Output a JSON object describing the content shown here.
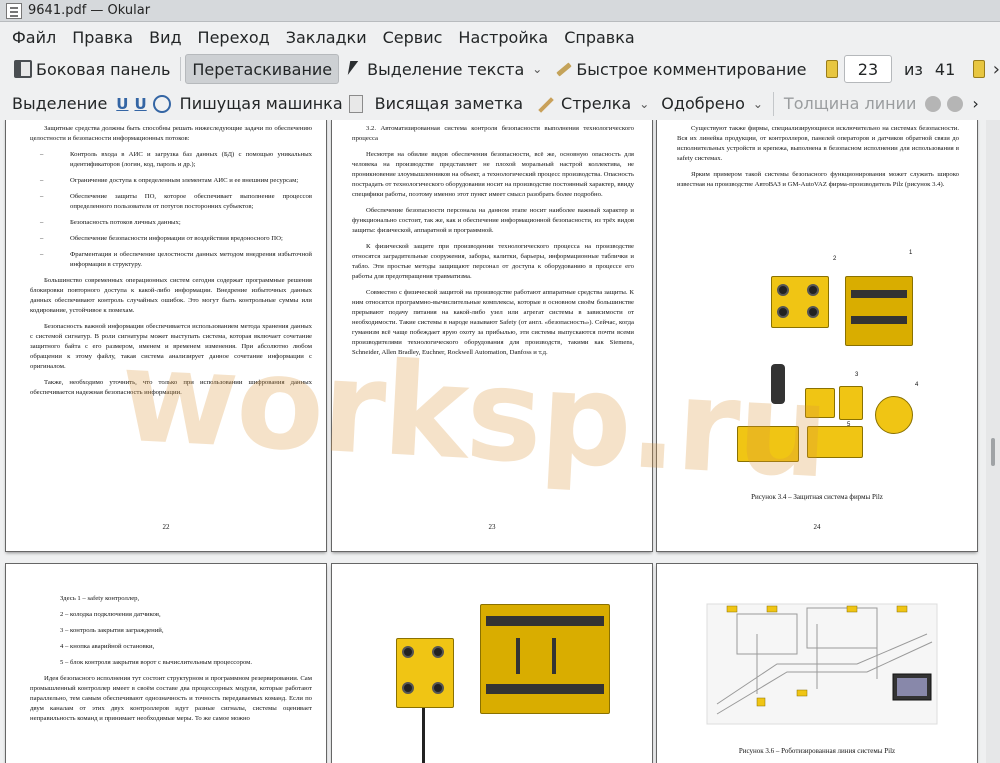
{
  "window": {
    "title": "9641.pdf  — Okular"
  },
  "menubar": {
    "items": [
      "Файл",
      "Правка",
      "Вид",
      "Переход",
      "Закладки",
      "Сервис",
      "Настройка",
      "Справка"
    ]
  },
  "toolbar1": {
    "sidebar": "Боковая панель",
    "drag": "Перетаскивание",
    "text_select": "Выделение текста",
    "quick_comment": "Быстрое комментирование",
    "page_current": "23",
    "page_of": "из",
    "page_total": "41"
  },
  "toolbar2": {
    "selection": "Выделение",
    "typewriter": "Пишущая машинка",
    "sticky_note": "Висящая заметка",
    "arrow": "Стрелка",
    "approved": "Одобрено",
    "line_width": "Толщина линии"
  },
  "pages": {
    "p22": {
      "paragraphs": [
        "Защитные средства должны быть способны решать нижеследующие задачи по обеспечению целостности и безопасности информационных потоков:",
        "Контроль входа в АИС и загрузка баз данных (БД) с помощью уникальных идентификаторов (логин, код, пароль и др.);",
        "Ограничение доступа к определенным элементам АИС и ее внешним ресурсам;",
        "Обеспечение защиты ПО, которое обеспечивает выполнение процессов определенного пользователя от потугов посторонних субъектов;",
        "Безопасность потоков личных данных;",
        "Обеспечение безопасности информации от воздействия вредоносного ПО;",
        "Фрагментация и обеспечение целостности данных методом внедрения избыточной информации в структуру.",
        "Большинство современных операционных систем сегодня содержат программные решения блокировки повторного доступа к какой-либо информации. Внедрение избыточных данных данных обеспечивают контроль случайных ошибок. Это могут быть контрольные суммы или кодирование, устойчивое к помехам.",
        "Безопасность важной информации обеспечивается использованием метода хранения данных с системой сигнатур. В роли сигнатуры может выступать система, которая включает сочетание защитного байта с его размером, именем и временем изменения. При абсолютно любом обращении к этому файлу, такая система анализирует данное сочетание информации с оригиналом.",
        "Также, необходимо уточнить, что только при использовании шифрования данных обеспечивается надежная безопасность информации."
      ],
      "number": "22"
    },
    "p23": {
      "paragraphs": [
        "3.2. Автоматизированная система контроля безопасности выполнения технологического процесса",
        "Несмотря на обилие видов обеспечения безопасности, всё же, основную опасность для человека на производстве представляет не плохой моральный настрой коллектива, не проникновение злоумышленников на объект, а технологический процесс производства. Опасность пострадать от технологического оборудования носит на производстве постоянный характер, ввиду специфики работы, поэтому именно этот пункт имеет смысл разобрать более подробно.",
        "Обеспечение безопасности персонала на данном этапе носит наиболее важный характер и функционально состоит, так же, как и обеспечение информационной безопасности, из трёх видов защиты: физической, аппаратной и программной.",
        "К физической защите при производении технологического процесса на производстве относятся заградительные сооружения, заборы, калитки, барьеры, информационные таблички и табло. Эти простые методы защищают персонал от доступа к оборудованию в процессе его работы для предотвращения травматизма.",
        "Совместно с физической защитой на производстве работают аппаратные средства защиты. К ним относятся программно-вычислительные комплексы, которые в основном своём большинстве прерывают подачу питания на какой-либо узел или агрегат системы в зависимости от необходимости. Такие системы в народе называют Safety (от англ. «безопасность»). Сейчас, когда гуманизм всё чаще побеждает ярую охоту за прибылью, эти системы выпускаются почти всеми производителями технологического оборудования для производств, такими как Siemens, Schneider, Allen Bradley, Euchner, Rockwell Automation, Danfoss и т.д."
      ],
      "number": "23"
    },
    "p24": {
      "paragraphs": [
        "Существуют также фирмы, специализирующиеся исключительно на системах безопасности. Вся их линейка продукции, от контроллеров, панелей операторов и датчиков обратной связи до исполнительных устройств и крепежа, выполнена в безопасном исполнении для использования в safety системах.",
        "Ярким примером такой системы безопасного функционирования может служить широко известная на производстве АвтоВАЗ и GM-AutoVAZ фирма-производитель Pilz (рисунок 3.4)."
      ],
      "caption": "Рисунок 3.4 – Защитная система фирмы Pilz",
      "callouts": [
        "1",
        "2",
        "3",
        "4",
        "5"
      ],
      "number": "24"
    },
    "p25": {
      "paragraphs": [
        "Здесь 1 – safety контроллер,",
        "2 – колодка подключения датчиков,",
        "3 – контроль закрытия заграждений,",
        "4 – кнопка аварийной остановки,",
        "5 – блок контроля закрытия ворот с вычислительным процессором.",
        "Идея безопасного исполнения тут состоит структурном и программном резервировании. Сам промышленный контроллер имеет в своём составе два процессорных модуля, которые работают параллельно, тем самым обеспечивают однозначность и точность передаваемых команд. Если по двум каналам от этих двух контроллеров идут разные сигналы, системы оценивает неправильность команд и принимает необходимые меры. То же самое можно"
      ]
    },
    "p27": {
      "caption": "Рисунок 3.6 – Роботизированная линия системы Pilz"
    }
  },
  "watermark": "worksp.ru",
  "colors": {
    "device_yellow": "#f0c514",
    "watermark": "#dc963c",
    "window_bg": "#eff0f1"
  }
}
